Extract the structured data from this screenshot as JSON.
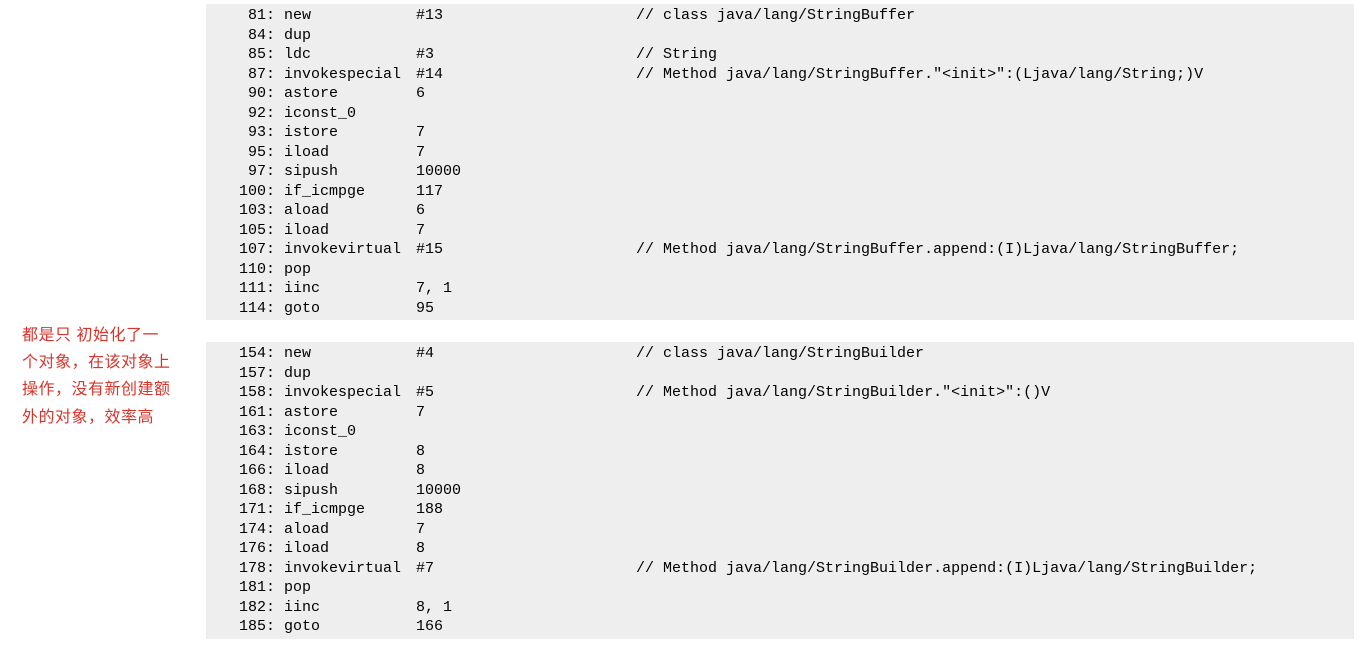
{
  "annotation": {
    "text": "都是只 初始化了一个对象，在该对象上操作，没有新创建额外的对象，效率高"
  },
  "blocks": [
    {
      "lines": [
        {
          "offset": "81",
          "op": "new",
          "arg": "#13",
          "comment": "// class java/lang/StringBuffer"
        },
        {
          "offset": "84",
          "op": "dup",
          "arg": "",
          "comment": ""
        },
        {
          "offset": "85",
          "op": "ldc",
          "arg": "#3",
          "comment": "// String"
        },
        {
          "offset": "87",
          "op": "invokespecial",
          "arg": "#14",
          "comment": "// Method java/lang/StringBuffer.\"<init>\":(Ljava/lang/String;)V"
        },
        {
          "offset": "90",
          "op": "astore",
          "arg": "6",
          "comment": ""
        },
        {
          "offset": "92",
          "op": "iconst_0",
          "arg": "",
          "comment": ""
        },
        {
          "offset": "93",
          "op": "istore",
          "arg": "7",
          "comment": ""
        },
        {
          "offset": "95",
          "op": "iload",
          "arg": "7",
          "comment": ""
        },
        {
          "offset": "97",
          "op": "sipush",
          "arg": "10000",
          "comment": ""
        },
        {
          "offset": "100",
          "op": "if_icmpge",
          "arg": "117",
          "comment": ""
        },
        {
          "offset": "103",
          "op": "aload",
          "arg": "6",
          "comment": ""
        },
        {
          "offset": "105",
          "op": "iload",
          "arg": "7",
          "comment": ""
        },
        {
          "offset": "107",
          "op": "invokevirtual",
          "arg": "#15",
          "comment": "// Method java/lang/StringBuffer.append:(I)Ljava/lang/StringBuffer;"
        },
        {
          "offset": "110",
          "op": "pop",
          "arg": "",
          "comment": ""
        },
        {
          "offset": "111",
          "op": "iinc",
          "arg": "7, 1",
          "comment": ""
        },
        {
          "offset": "114",
          "op": "goto",
          "arg": "95",
          "comment": ""
        }
      ]
    },
    {
      "lines": [
        {
          "offset": "154",
          "op": "new",
          "arg": "#4",
          "comment": "// class java/lang/StringBuilder"
        },
        {
          "offset": "157",
          "op": "dup",
          "arg": "",
          "comment": ""
        },
        {
          "offset": "158",
          "op": "invokespecial",
          "arg": "#5",
          "comment": "// Method java/lang/StringBuilder.\"<init>\":()V"
        },
        {
          "offset": "161",
          "op": "astore",
          "arg": "7",
          "comment": ""
        },
        {
          "offset": "163",
          "op": "iconst_0",
          "arg": "",
          "comment": ""
        },
        {
          "offset": "164",
          "op": "istore",
          "arg": "8",
          "comment": ""
        },
        {
          "offset": "166",
          "op": "iload",
          "arg": "8",
          "comment": ""
        },
        {
          "offset": "168",
          "op": "sipush",
          "arg": "10000",
          "comment": ""
        },
        {
          "offset": "171",
          "op": "if_icmpge",
          "arg": "188",
          "comment": ""
        },
        {
          "offset": "174",
          "op": "aload",
          "arg": "7",
          "comment": ""
        },
        {
          "offset": "176",
          "op": "iload",
          "arg": "8",
          "comment": ""
        },
        {
          "offset": "178",
          "op": "invokevirtual",
          "arg": "#7",
          "comment": "// Method java/lang/StringBuilder.append:(I)Ljava/lang/StringBuilder;"
        },
        {
          "offset": "181",
          "op": "pop",
          "arg": "",
          "comment": ""
        },
        {
          "offset": "182",
          "op": "iinc",
          "arg": "8, 1",
          "comment": ""
        },
        {
          "offset": "185",
          "op": "goto",
          "arg": "166",
          "comment": ""
        }
      ]
    }
  ]
}
